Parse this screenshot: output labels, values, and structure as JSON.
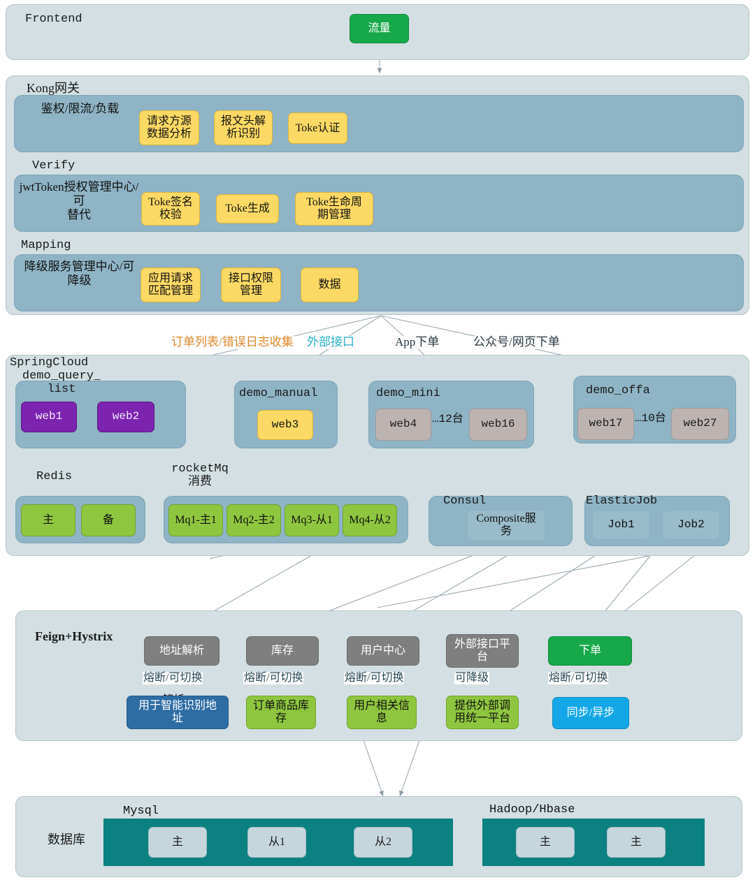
{
  "frontend": {
    "title": "Frontend",
    "traffic_node": "流量"
  },
  "kong": {
    "title": "Kong网关",
    "bands": [
      {
        "label": "鉴权/限流/负载",
        "section_title": "",
        "nodes": [
          "请求方源\n数据分析",
          "报文头解\n析识别",
          "Toke认证"
        ]
      },
      {
        "label": "jwtToken授权管理中心/可\n替代",
        "section_title": "Verify",
        "nodes": [
          "Toke签名\n校验",
          "Toke生成",
          "Toke生命周\n期管理"
        ]
      },
      {
        "label": "降级服务管理中心/可\n降级",
        "section_title": "Mapping",
        "nodes": [
          "应用请求\n匹配管理",
          "接口权限\n管理",
          "数据"
        ]
      }
    ]
  },
  "edge_labels": [
    {
      "text": "订单列表/错误日志收集",
      "color": "orange"
    },
    {
      "text": "外部接口",
      "color": "cyan"
    },
    {
      "text": "App下单",
      "color": "dark"
    },
    {
      "text": "公众号/网页下单",
      "color": "dark"
    }
  ],
  "springcloud": {
    "title": "SpringCloud",
    "services": [
      {
        "name": "demo_query_\nlist",
        "nodes": [
          "web1",
          "web2"
        ],
        "style": "purple",
        "ellipsis": ""
      },
      {
        "name": "demo_manual",
        "nodes": [
          "web3"
        ],
        "style": "yellow",
        "ellipsis": ""
      },
      {
        "name": "demo_mini",
        "nodes": [
          "web4",
          "web16"
        ],
        "style": "gray",
        "ellipsis": "…12台"
      },
      {
        "name": "demo_offa",
        "nodes": [
          "web17",
          "web27"
        ],
        "style": "gray",
        "ellipsis": "…10台"
      }
    ],
    "infra": [
      {
        "title": "Redis",
        "nodes": [
          "主",
          "备"
        ],
        "style": "green"
      },
      {
        "title": "rocketMq\n消费",
        "nodes": [
          "Mq1-主1",
          "Mq2-主2",
          "Mq3-从1",
          "Mq4-从2"
        ],
        "style": "green"
      },
      {
        "title": "Consul",
        "nodes": [
          "Composite服\n务"
        ],
        "style": "ghost"
      },
      {
        "title": "ElasticJob",
        "nodes": [
          "Job1",
          "Job2"
        ],
        "style": "ghost"
      }
    ]
  },
  "feign": {
    "title": "Feign+Hystrix",
    "columns": [
      {
        "top": "地址解析",
        "mid": "熔断/可切换",
        "extra": "解析",
        "bottom": "用于智能识别地\n址",
        "bottom_style": "blue"
      },
      {
        "top": "库存",
        "mid": "熔断/可切换",
        "extra": "",
        "bottom": "订单商品库\n存",
        "bottom_style": "green"
      },
      {
        "top": "用户中心",
        "mid": "熔断/可切换",
        "extra": "",
        "bottom": "用户相关信\n息",
        "bottom_style": "green"
      },
      {
        "top": "外部接口平\n台",
        "mid": "可降级",
        "extra": "",
        "bottom": "提供外部调\n用统一平台",
        "bottom_style": "green"
      },
      {
        "top": "下单",
        "top_style": "brightgreen",
        "mid": "熔断/可切换",
        "extra": "",
        "bottom": "同步/异步",
        "bottom_style": "cyan"
      }
    ]
  },
  "database": {
    "title": "数据库",
    "groups": [
      {
        "title": "Mysql",
        "nodes": [
          "主",
          "从1",
          "从2"
        ]
      },
      {
        "title": "Hadoop/Hbase",
        "nodes": [
          "主",
          "主"
        ]
      }
    ]
  },
  "colors": {
    "panel_bg": "#d3dfe2",
    "band_bg": "#8eb4c5",
    "yellow": "#fcd965",
    "purple": "#7c23b0",
    "gray": "#bdb4b2",
    "green": "#8ec63f",
    "dark_gray": "#7f7f7f",
    "bright_green": "#17a84a",
    "blue": "#2e6da4",
    "cyan": "#14a7e8",
    "teal_db": "#0c8181",
    "edge": "#8a9aa3"
  }
}
